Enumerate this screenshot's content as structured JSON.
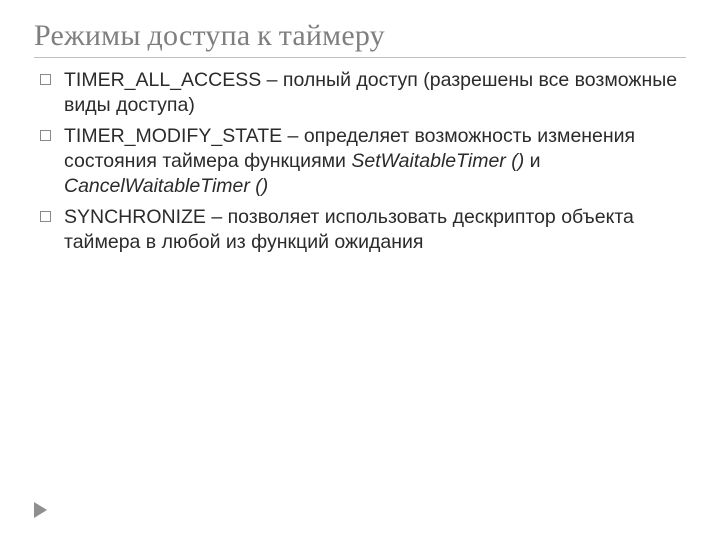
{
  "title": "Режимы доступа к таймеру",
  "items": [
    {
      "name_prefix": "TIMER_ALL_ACCESS",
      "rest": " – полный доступ (разрешены все возможные виды доступа)",
      "italic_parts": []
    },
    {
      "name_prefix": "TIMER_",
      "small_caps": "MODIFY_STATE",
      "rest_before_italic": " – определяет возможность изменения состояния таймера функциями ",
      "italic1": "SetWaitableTimer ()",
      "between": " и ",
      "italic2": "CancelWaitableTimer ()"
    },
    {
      "name_prefix": "SYNCHRONIZE",
      "rest": " – позволяет использовать дескриптор объекта таймера в любой из функций ожидания",
      "italic_parts": []
    }
  ]
}
